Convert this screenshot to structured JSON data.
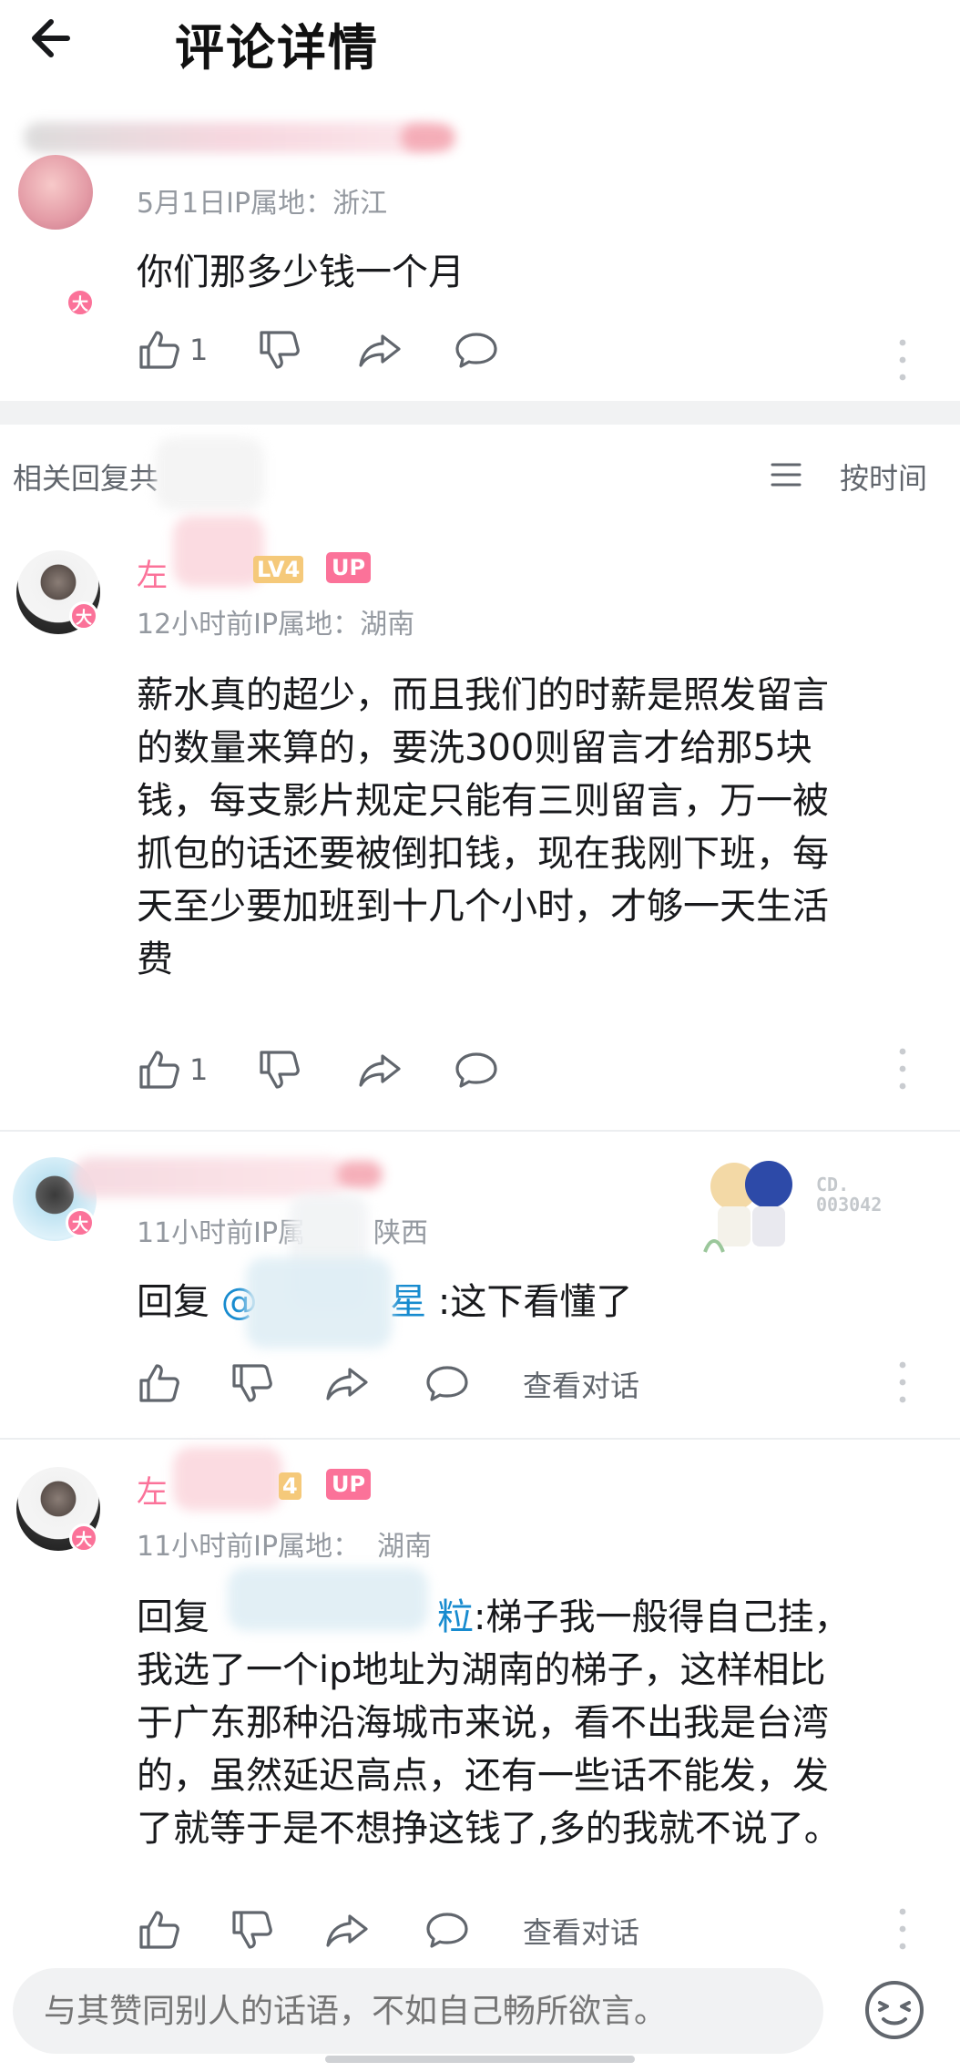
{
  "header": {
    "title": "评论详情"
  },
  "top_comment": {
    "meta": "5月1日IP属地：浙江",
    "text": "你们那多少钱一个月",
    "like_count": "1",
    "badge": "大"
  },
  "related": {
    "label": "相关回复共",
    "sort_label": "按时间"
  },
  "replies": [
    {
      "name": "左",
      "level": "LV4",
      "up": "UP",
      "meta": "12小时前IP属地：湖南",
      "lines": [
        "薪水真的超少，而且我们的时薪是照发留言",
        "的数量来算的，要洗300则留言才给那5块",
        "钱，每支影片规定只能有三则留言，万一被",
        "抓包的话还要被倒扣钱，现在我刚下班，每",
        "天至少要加班到十几个小时，才够一天生活",
        "费"
      ],
      "like_count": "1",
      "badge": "大"
    },
    {
      "meta_prefix": "11小时前IP属",
      "meta_suffix": "陕西",
      "reply_prefix": "回复",
      "mention": "@",
      "mention_tail": "星",
      "reply_text": ":这下看懂了",
      "view_conversation": "查看对话",
      "sticker_code_1": "CD.",
      "sticker_code_2": "003042",
      "badge": "大"
    },
    {
      "name": "左",
      "level": "4",
      "up": "UP",
      "meta_prefix": "11小时前IP属地：",
      "meta_suffix": "湖南",
      "reply_prefix": "回复",
      "mention_tail": "粒",
      "first_line_text": ":梯子我一般得自己挂，",
      "lines": [
        "我选了一个ip地址为湖南的梯子，这样相比",
        "于广东那种沿海城市来说，看不出我是台湾",
        "的，虽然延迟高点，还有一些话不能发，发",
        "了就等于是不想挣这钱了,多的我就不说了。"
      ],
      "view_conversation": "查看对话",
      "badge": "大"
    }
  ],
  "input": {
    "placeholder": "与其赞同别人的话语，不如自己畅所欲言。"
  }
}
